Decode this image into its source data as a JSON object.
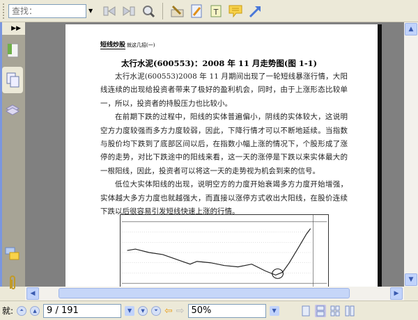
{
  "toolbar": {
    "search_placeholder": "查找："
  },
  "document": {
    "header_bold": "短线炒股",
    "header_small": "就这几招(一)",
    "title": "太行水泥(600553)：2008 年 11 月走势图(图 1-1)",
    "paragraphs": [
      "太行水泥(600553)2008 年 11 月期间出现了一轮短线暴涨行情，大阳线连续的出现给投资者带来了极好的盈利机会，同时，由于上涨形态比较单一，所以，投资者的持股压力也比较小。",
      "在前期下跌的过程中，阳线的实体普遍偏小，阴线的实体较大，这说明空方力度较强而多方力度较弱，因此，下降行情才可以不断地延续。当指数与股价均下跌到了底部区间以后，在指数小幅上涨的情况下，个股形成了涨停的走势，对比下跌途中的阳线来看，这一天的涨停是下跌以来实体最大的一根阳线，因此，投资者可以将这一天的走势视为机会到来的信号。",
      "低位大实体阳线的出现，说明空方的力度开始衰竭多方力度开始增强，实体越大多方力度也就越强大，而直接以涨停方式收出大阳线，在股价连续下跌以后很容易引发短线快速上涨的行情。"
    ]
  },
  "navigation": {
    "label": "就:",
    "page_value": "9 / 191",
    "zoom_value": "50%"
  }
}
